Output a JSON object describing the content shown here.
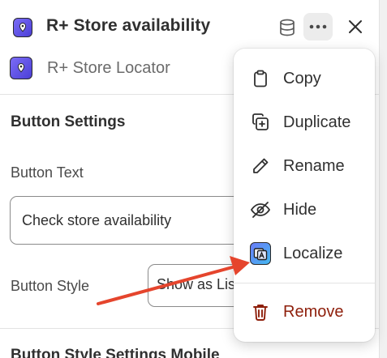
{
  "header": {
    "title": "R+ Store availability",
    "app_name": "R+ Store Locator"
  },
  "section": {
    "button_settings_title": "Button Settings",
    "button_text_label": "Button Text",
    "button_text_value": "Check store availability",
    "button_style_label": "Button Style",
    "button_style_value": "Show as List",
    "next_section_title": "Button Style Settings Mobile"
  },
  "menu": {
    "items": [
      {
        "label": "Copy",
        "icon": "clipboard-icon"
      },
      {
        "label": "Duplicate",
        "icon": "duplicate-icon"
      },
      {
        "label": "Rename",
        "icon": "pencil-icon"
      },
      {
        "label": "Hide",
        "icon": "eye-slash-icon"
      },
      {
        "label": "Localize",
        "icon": "localize-icon"
      },
      {
        "label": "Remove",
        "icon": "trash-icon"
      }
    ]
  },
  "colors": {
    "danger": "#8e1f0b",
    "arrow": "#e5452d",
    "app_icon": "#5b4ee6"
  }
}
